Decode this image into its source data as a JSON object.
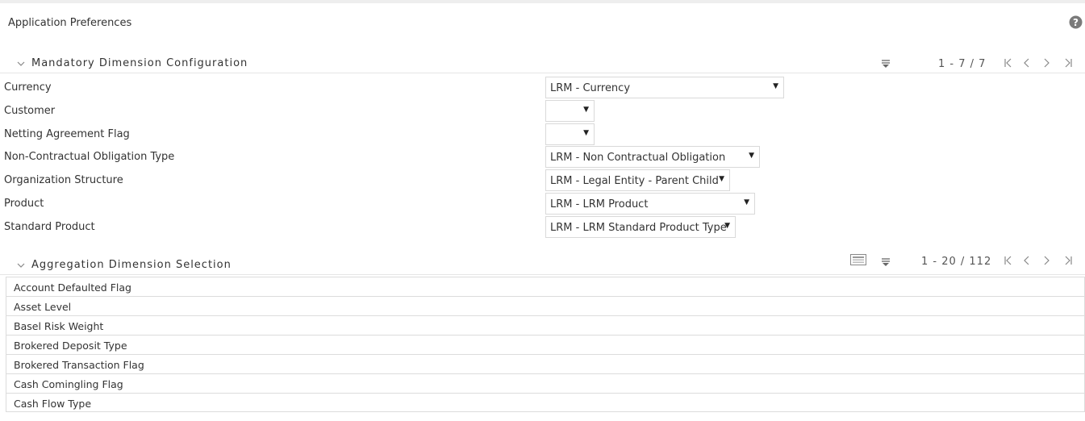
{
  "page": {
    "title": "Application Preferences",
    "help_icon": "help-circle-icon"
  },
  "mandatory": {
    "title": "Mandatory Dimension Configuration",
    "pager": "1 - 7 / 7",
    "rows": [
      {
        "label": "Currency",
        "value": "LRM - Currency"
      },
      {
        "label": "Customer",
        "value": ""
      },
      {
        "label": "Netting Agreement Flag",
        "value": ""
      },
      {
        "label": "Non-Contractual Obligation Type",
        "value": "LRM - Non Contractual Obligation"
      },
      {
        "label": "Organization Structure",
        "value": "LRM - Legal Entity - Parent Child"
      },
      {
        "label": "Product",
        "value": "LRM - LRM Product"
      },
      {
        "label": "Standard Product",
        "value": "LRM - LRM Standard Product Type"
      }
    ]
  },
  "aggregation": {
    "title": "Aggregation Dimension Selection",
    "pager": "1 - 20 / 112",
    "items": [
      "Account Defaulted Flag",
      "Asset Level",
      "Basel Risk Weight",
      "Brokered Deposit Type",
      "Brokered Transaction Flag",
      "Cash Comingling Flag",
      "Cash Flow Type"
    ]
  }
}
